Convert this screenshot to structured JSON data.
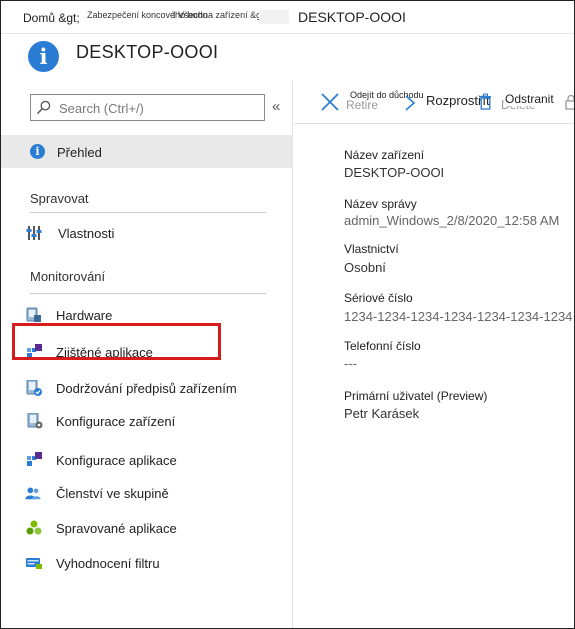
{
  "breadcrumb": {
    "home": "Domů &gt;",
    "part2": "Zabezpečení koncového bodu",
    "separator": "I",
    "part3": "Všechna zařízení &gt;",
    "current": "DESKTOP-OOOI"
  },
  "header": {
    "title": "DESKTOP-OOOI",
    "icon": "info-icon"
  },
  "sidebar": {
    "search_placeholder": "Search (Ctrl+/)",
    "collapse_glyph": "«",
    "overview": "Přehled",
    "section_manage": "Spravovat",
    "properties": "Vlastnosti",
    "section_monitor": "Monitorování",
    "items": [
      {
        "label": "Hardware",
        "icon": "hardware-icon"
      },
      {
        "label": "Zjištěné aplikace",
        "icon": "discovered-apps-icon"
      },
      {
        "label": "Dodržování předpisů zařízením",
        "icon": "device-compliance-icon"
      },
      {
        "label": "Konfigurace zařízení",
        "icon": "device-configuration-icon"
      },
      {
        "label": "Konfigurace aplikace",
        "icon": "app-configuration-icon"
      },
      {
        "label": "Členství ve skupině",
        "icon": "group-membership-icon"
      },
      {
        "label": "Spravované aplikace",
        "icon": "managed-apps-icon"
      },
      {
        "label": "Vyhodnocení filtru",
        "icon": "filter-evaluation-icon"
      }
    ]
  },
  "commands": {
    "retire": "Odejít do důchodu",
    "retire_ghost": "Retire",
    "wipe": "Rozprostřít",
    "delete": "Odstranit",
    "delete_ghost": "Delete"
  },
  "properties": [
    {
      "label": "Název zařízení",
      "value": "DESKTOP-OOOI"
    },
    {
      "label": "Název správy",
      "value": "admin_Windows_2/8/2020_12:58 AM"
    },
    {
      "label": "Vlastnictví",
      "value": "Osobní"
    },
    {
      "label": "Sériové číslo",
      "value": "1234-1234-1234-1234-1234-1234-1234"
    },
    {
      "label": "Telefonní číslo",
      "value": "---"
    },
    {
      "label": "Primární uživatel (Preview)",
      "value": "Petr Karásek"
    }
  ],
  "colors": {
    "accent": "#2b7cd3",
    "highlight_border": "#d61c1c",
    "selected_bg": "#e9e9e9"
  }
}
